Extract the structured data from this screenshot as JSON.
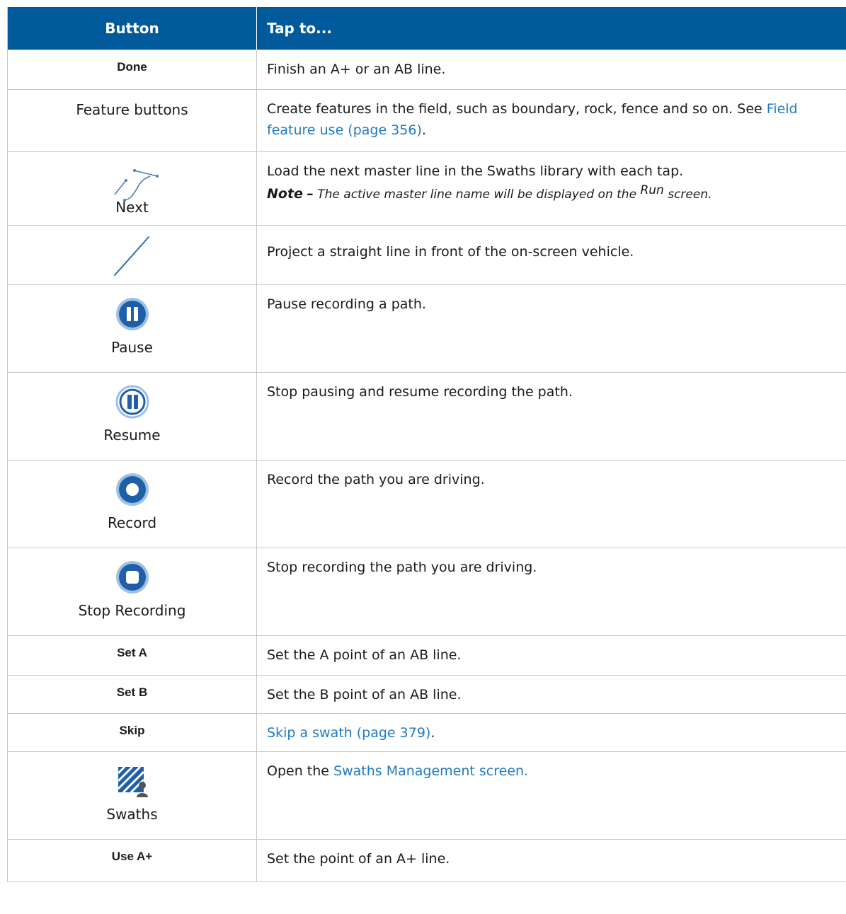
{
  "header": {
    "col1": "Button",
    "col2": "Tap to..."
  },
  "rows": [
    {
      "button": "Done",
      "desc": "Finish an A+ or an AB line."
    },
    {
      "button": "Feature buttons",
      "desc_pre": "Create features in the field, such as boundary, rock, fence and so on. See ",
      "desc_link": "Field feature use (page 356)",
      "desc_post": "."
    },
    {
      "button": "Next",
      "icon": "curved-lines-icon",
      "desc": "Load the next master line in the Swaths library with each tap.",
      "note_label": "Note",
      "note_dash": "–",
      "note_pre": "The active master line name will be displayed on the",
      "note_run": "Run",
      "note_post": "screen."
    },
    {
      "icon": "straight-line-icon",
      "desc": "Project a straight line in front of the on-screen vehicle."
    },
    {
      "button": "Pause",
      "icon": "pause-filled-icon",
      "desc": "Pause recording a path."
    },
    {
      "button": "Resume",
      "icon": "pause-outline-icon",
      "desc": "Stop pausing and resume recording the path."
    },
    {
      "button": "Record",
      "icon": "record-icon",
      "desc": "Record the path you are driving."
    },
    {
      "button": "Stop Recording",
      "icon": "stop-recording-icon",
      "desc": "Stop recording the path you are driving."
    },
    {
      "button": "Set A",
      "desc": "Set the A point of an AB line."
    },
    {
      "button": "Set B",
      "desc": "Set the B point of an AB line."
    },
    {
      "button": "Skip",
      "desc_link": "Skip a swath (page 379)",
      "desc_post": "."
    },
    {
      "button": "Swaths",
      "icon": "swaths-icon",
      "desc_pre": "Open the ",
      "desc_link": "Swaths Management screen."
    },
    {
      "button": "Use A+",
      "desc": "Set the point of an A+ line."
    }
  ],
  "colors": {
    "header_bg": "#005a9c",
    "link": "#1e7bc4",
    "icon_blue": "#1f5fa8",
    "border": "#c8c8c8"
  }
}
